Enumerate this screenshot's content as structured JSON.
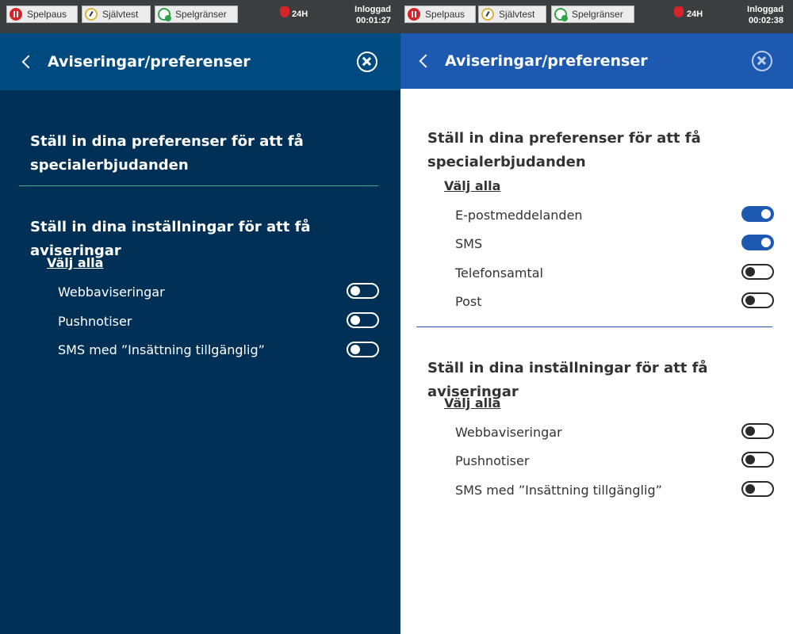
{
  "toolbar": {
    "pause_label": "Spelpaus",
    "selftest_label": "Självtest",
    "limits_label": "Spelgränser",
    "badge_24h": "24H",
    "login_label": "Inloggad"
  },
  "left": {
    "header_title": "Aviseringar/preferenser",
    "session_time": "00:01:27",
    "offers_title": "Ställ in dina preferenser för att få specialerbjudanden",
    "notifications_title": "Ställ in dina inställningar för att få aviseringar",
    "select_all_label": "Välj alla",
    "notifications": [
      {
        "label": "Webbaviseringar",
        "on": false
      },
      {
        "label": "Pushnotiser",
        "on": false
      },
      {
        "label": "SMS med ”Insättning tillgänglig”",
        "on": false
      }
    ]
  },
  "right": {
    "header_title": "Aviseringar/preferenser",
    "session_time": "00:02:38",
    "offers_title": "Ställ in dina preferenser för att få specialerbjudanden",
    "offers_select_all_label": "Välj alla",
    "offers": [
      {
        "label": "E-postmeddelanden",
        "on": true
      },
      {
        "label": "SMS",
        "on": true
      },
      {
        "label": "Telefonsamtal",
        "on": false
      },
      {
        "label": "Post",
        "on": false
      }
    ],
    "notifications_title": "Ställ in dina inställningar för att få aviseringar",
    "notifications_select_all_label": "Välj alla",
    "notifications": [
      {
        "label": "Webbaviseringar",
        "on": false
      },
      {
        "label": "Pushnotiser",
        "on": false
      },
      {
        "label": "SMS med ”Insättning tillgänglig”",
        "on": false
      }
    ]
  },
  "colors": {
    "left_bg": "#003055",
    "left_header": "#004a80",
    "right_header": "#1d59b0",
    "toggle_on": "#1d59b0",
    "left_divider": "#3fae8a"
  }
}
